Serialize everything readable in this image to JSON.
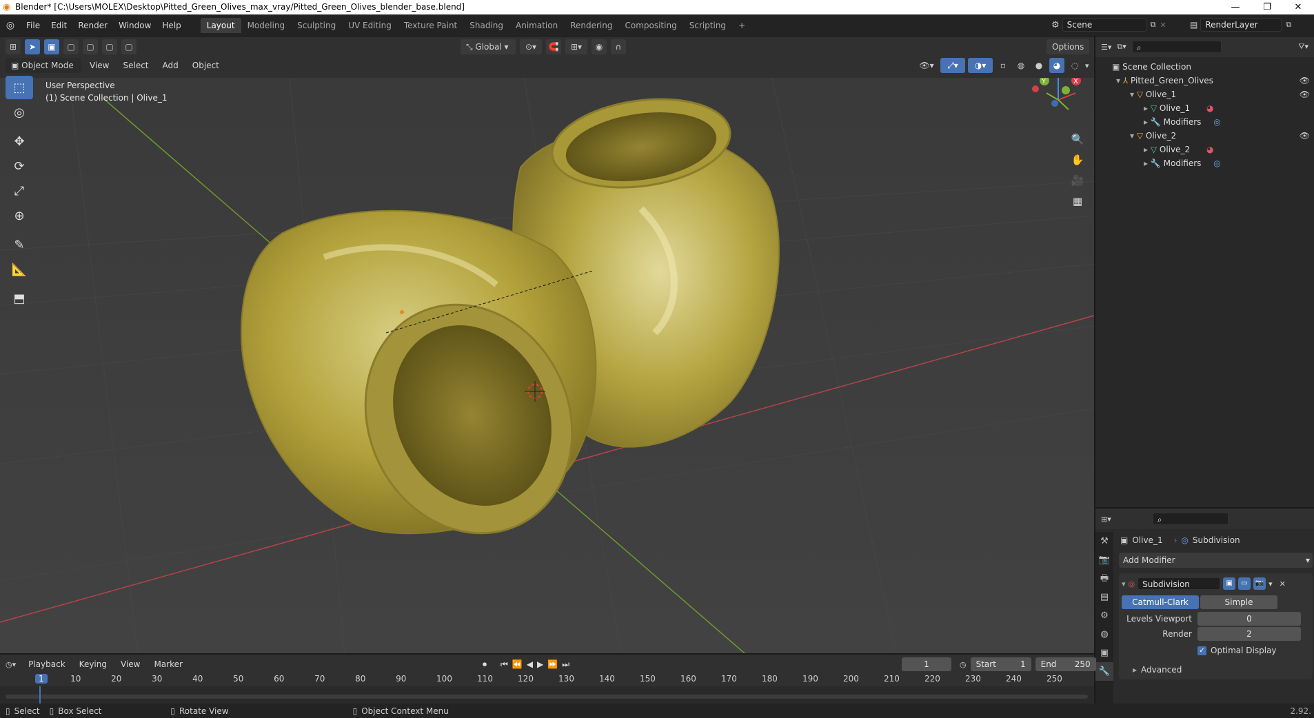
{
  "titlebar": {
    "title": "Blender* [C:\\Users\\MOLEX\\Desktop\\Pitted_Green_Olives_max_vray/Pitted_Green_Olives_blender_base.blend]",
    "minimize": "—",
    "maximize": "❐",
    "close": "✕"
  },
  "menu": [
    "File",
    "Edit",
    "Render",
    "Window",
    "Help"
  ],
  "workspaces": [
    "Layout",
    "Modeling",
    "Sculpting",
    "UV Editing",
    "Texture Paint",
    "Shading",
    "Animation",
    "Rendering",
    "Compositing",
    "Scripting"
  ],
  "workspace_add": "+",
  "scene": {
    "value": "Scene"
  },
  "renderlayer": {
    "value": "RenderLayer"
  },
  "viewport_header": {
    "orientation": "Global",
    "options": "Options",
    "mode": "Object Mode",
    "menus": [
      "View",
      "Select",
      "Add",
      "Object"
    ]
  },
  "viewport": {
    "perspective": "User Perspective",
    "collection": "(1) Scene Collection | Olive_1",
    "gizmo": {
      "x": "X",
      "y": "Y",
      "z": "Z"
    }
  },
  "outliner": {
    "root": "Scene Collection",
    "items": [
      {
        "label": "Pitted_Green_Olives",
        "indent": 1
      },
      {
        "label": "Olive_1",
        "indent": 2
      },
      {
        "label": "Olive_1",
        "indent": 3
      },
      {
        "label": "Modifiers",
        "indent": 3
      },
      {
        "label": "Olive_2",
        "indent": 2
      },
      {
        "label": "Olive_2",
        "indent": 3
      },
      {
        "label": "Modifiers",
        "indent": 3
      }
    ]
  },
  "properties": {
    "object": "Olive_1",
    "modifier_crumb": "Subdivision",
    "add_modifier": "Add Modifier",
    "modifier_name": "Subdivision",
    "type_catmull": "Catmull-Clark",
    "type_simple": "Simple",
    "levels_viewport_label": "Levels Viewport",
    "levels_viewport_value": "0",
    "render_label": "Render",
    "render_value": "2",
    "optimal_display": "Optimal Display",
    "advanced": "Advanced"
  },
  "timeline": {
    "menus": [
      "Playback",
      "Keying",
      "View",
      "Marker"
    ],
    "current_frame": "1",
    "start_label": "Start",
    "start_value": "1",
    "end_label": "End",
    "end_value": "250",
    "ticks": [
      "1",
      "10",
      "20",
      "30",
      "40",
      "50",
      "60",
      "70",
      "80",
      "90",
      "100",
      "110",
      "120",
      "130",
      "140",
      "150",
      "160",
      "170",
      "180",
      "190",
      "200",
      "210",
      "220",
      "230",
      "240",
      "250"
    ]
  },
  "status": {
    "select": "Select",
    "box_select": "Box Select",
    "rotate_view": "Rotate View",
    "context_menu": "Object Context Menu",
    "version": "2.92."
  },
  "colors": {
    "accent": "#4772b3",
    "olive": "#b6a43a",
    "x_axis": "#d5404b",
    "y_axis": "#7fb236",
    "z_axis": "#3d8fe6"
  }
}
